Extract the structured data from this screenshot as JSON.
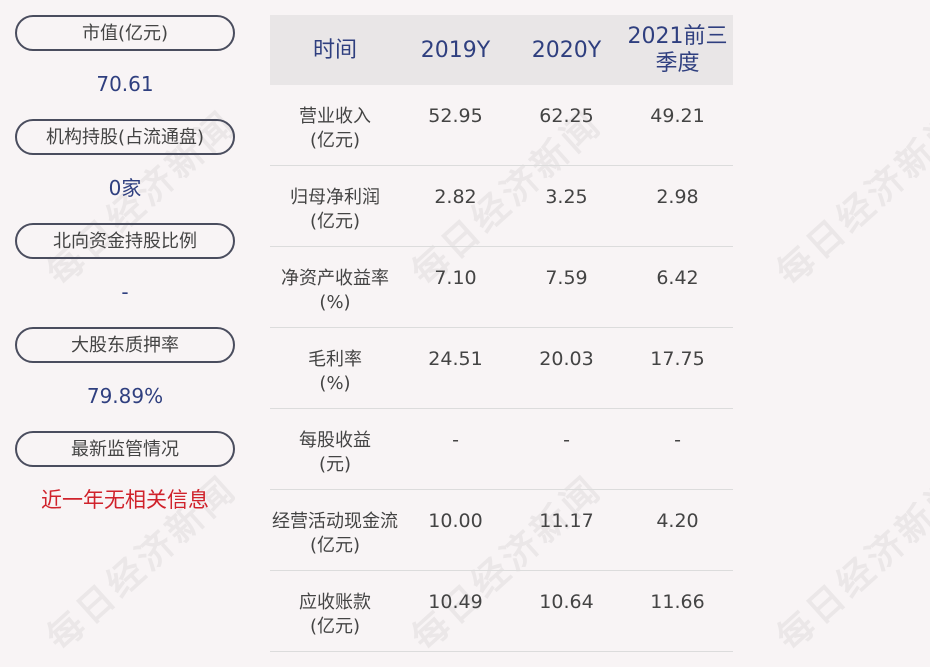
{
  "left_panel": [
    {
      "label": "市值(亿元)",
      "value": "70.61",
      "red": false
    },
    {
      "label": "机构持股(占流通盘)",
      "value": "0家",
      "red": false
    },
    {
      "label": "北向资金持股比例",
      "value": "-",
      "red": false
    },
    {
      "label": "大股东质押率",
      "value": "79.89%",
      "red": false
    },
    {
      "label": "最新监管情况",
      "value": "近一年无相关信息",
      "red": true
    }
  ],
  "table": {
    "header": {
      "col0": "时间",
      "col1": "2019Y",
      "col2": "2020Y",
      "col3": "2021前三季度"
    },
    "rows": [
      {
        "label1": "营业收入",
        "label2": "(亿元)",
        "v1": "52.95",
        "v2": "62.25",
        "v3": "49.21"
      },
      {
        "label1": "归母净利润",
        "label2": "(亿元)",
        "v1": "2.82",
        "v2": "3.25",
        "v3": "2.98"
      },
      {
        "label1": "净资产收益率",
        "label2": "(%)",
        "v1": "7.10",
        "v2": "7.59",
        "v3": "6.42"
      },
      {
        "label1": "毛利率",
        "label2": "(%)",
        "v1": "24.51",
        "v2": "20.03",
        "v3": "17.75"
      },
      {
        "label1": "每股收益",
        "label2": "(元)",
        "v1": "-",
        "v2": "-",
        "v3": "-"
      },
      {
        "label1": "经营活动现金流",
        "label2": "(亿元)",
        "v1": "10.00",
        "v2": "11.17",
        "v3": "4.20"
      },
      {
        "label1": "应收账款",
        "label2": "(亿元)",
        "v1": "10.49",
        "v2": "10.64",
        "v3": "11.66"
      }
    ]
  },
  "watermark": "每日经济新闻"
}
